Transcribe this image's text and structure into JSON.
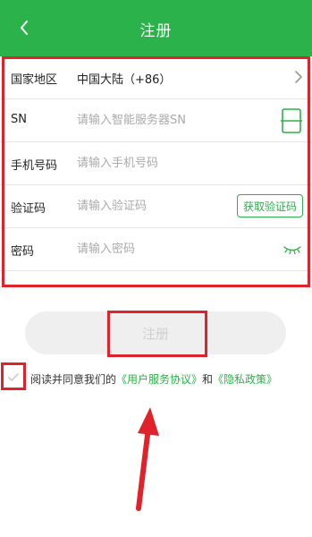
{
  "header": {
    "title": "注册",
    "back_icon": "chevron-left-icon"
  },
  "form": {
    "region": {
      "label": "国家地区",
      "value": "中国大陆（+86）"
    },
    "sn": {
      "label": "SN",
      "placeholder": "请输入智能服务器SN"
    },
    "phone": {
      "label": "手机号码",
      "placeholder": "请输入手机号码"
    },
    "code": {
      "label": "验证码",
      "placeholder": "请输入验证码",
      "button": "获取验证码"
    },
    "password": {
      "label": "密码",
      "placeholder": "请输入密码"
    }
  },
  "register_button": "注册",
  "agreement": {
    "prefix": "阅读并同意我们的",
    "terms": "《用户服务协议》",
    "and": "和",
    "privacy": "《隐私政策》"
  },
  "colors": {
    "primary": "#2bb24a",
    "annotation_red": "#e0232a",
    "disabled_button_bg": "#efefef",
    "disabled_button_text": "#cfcfcf"
  }
}
